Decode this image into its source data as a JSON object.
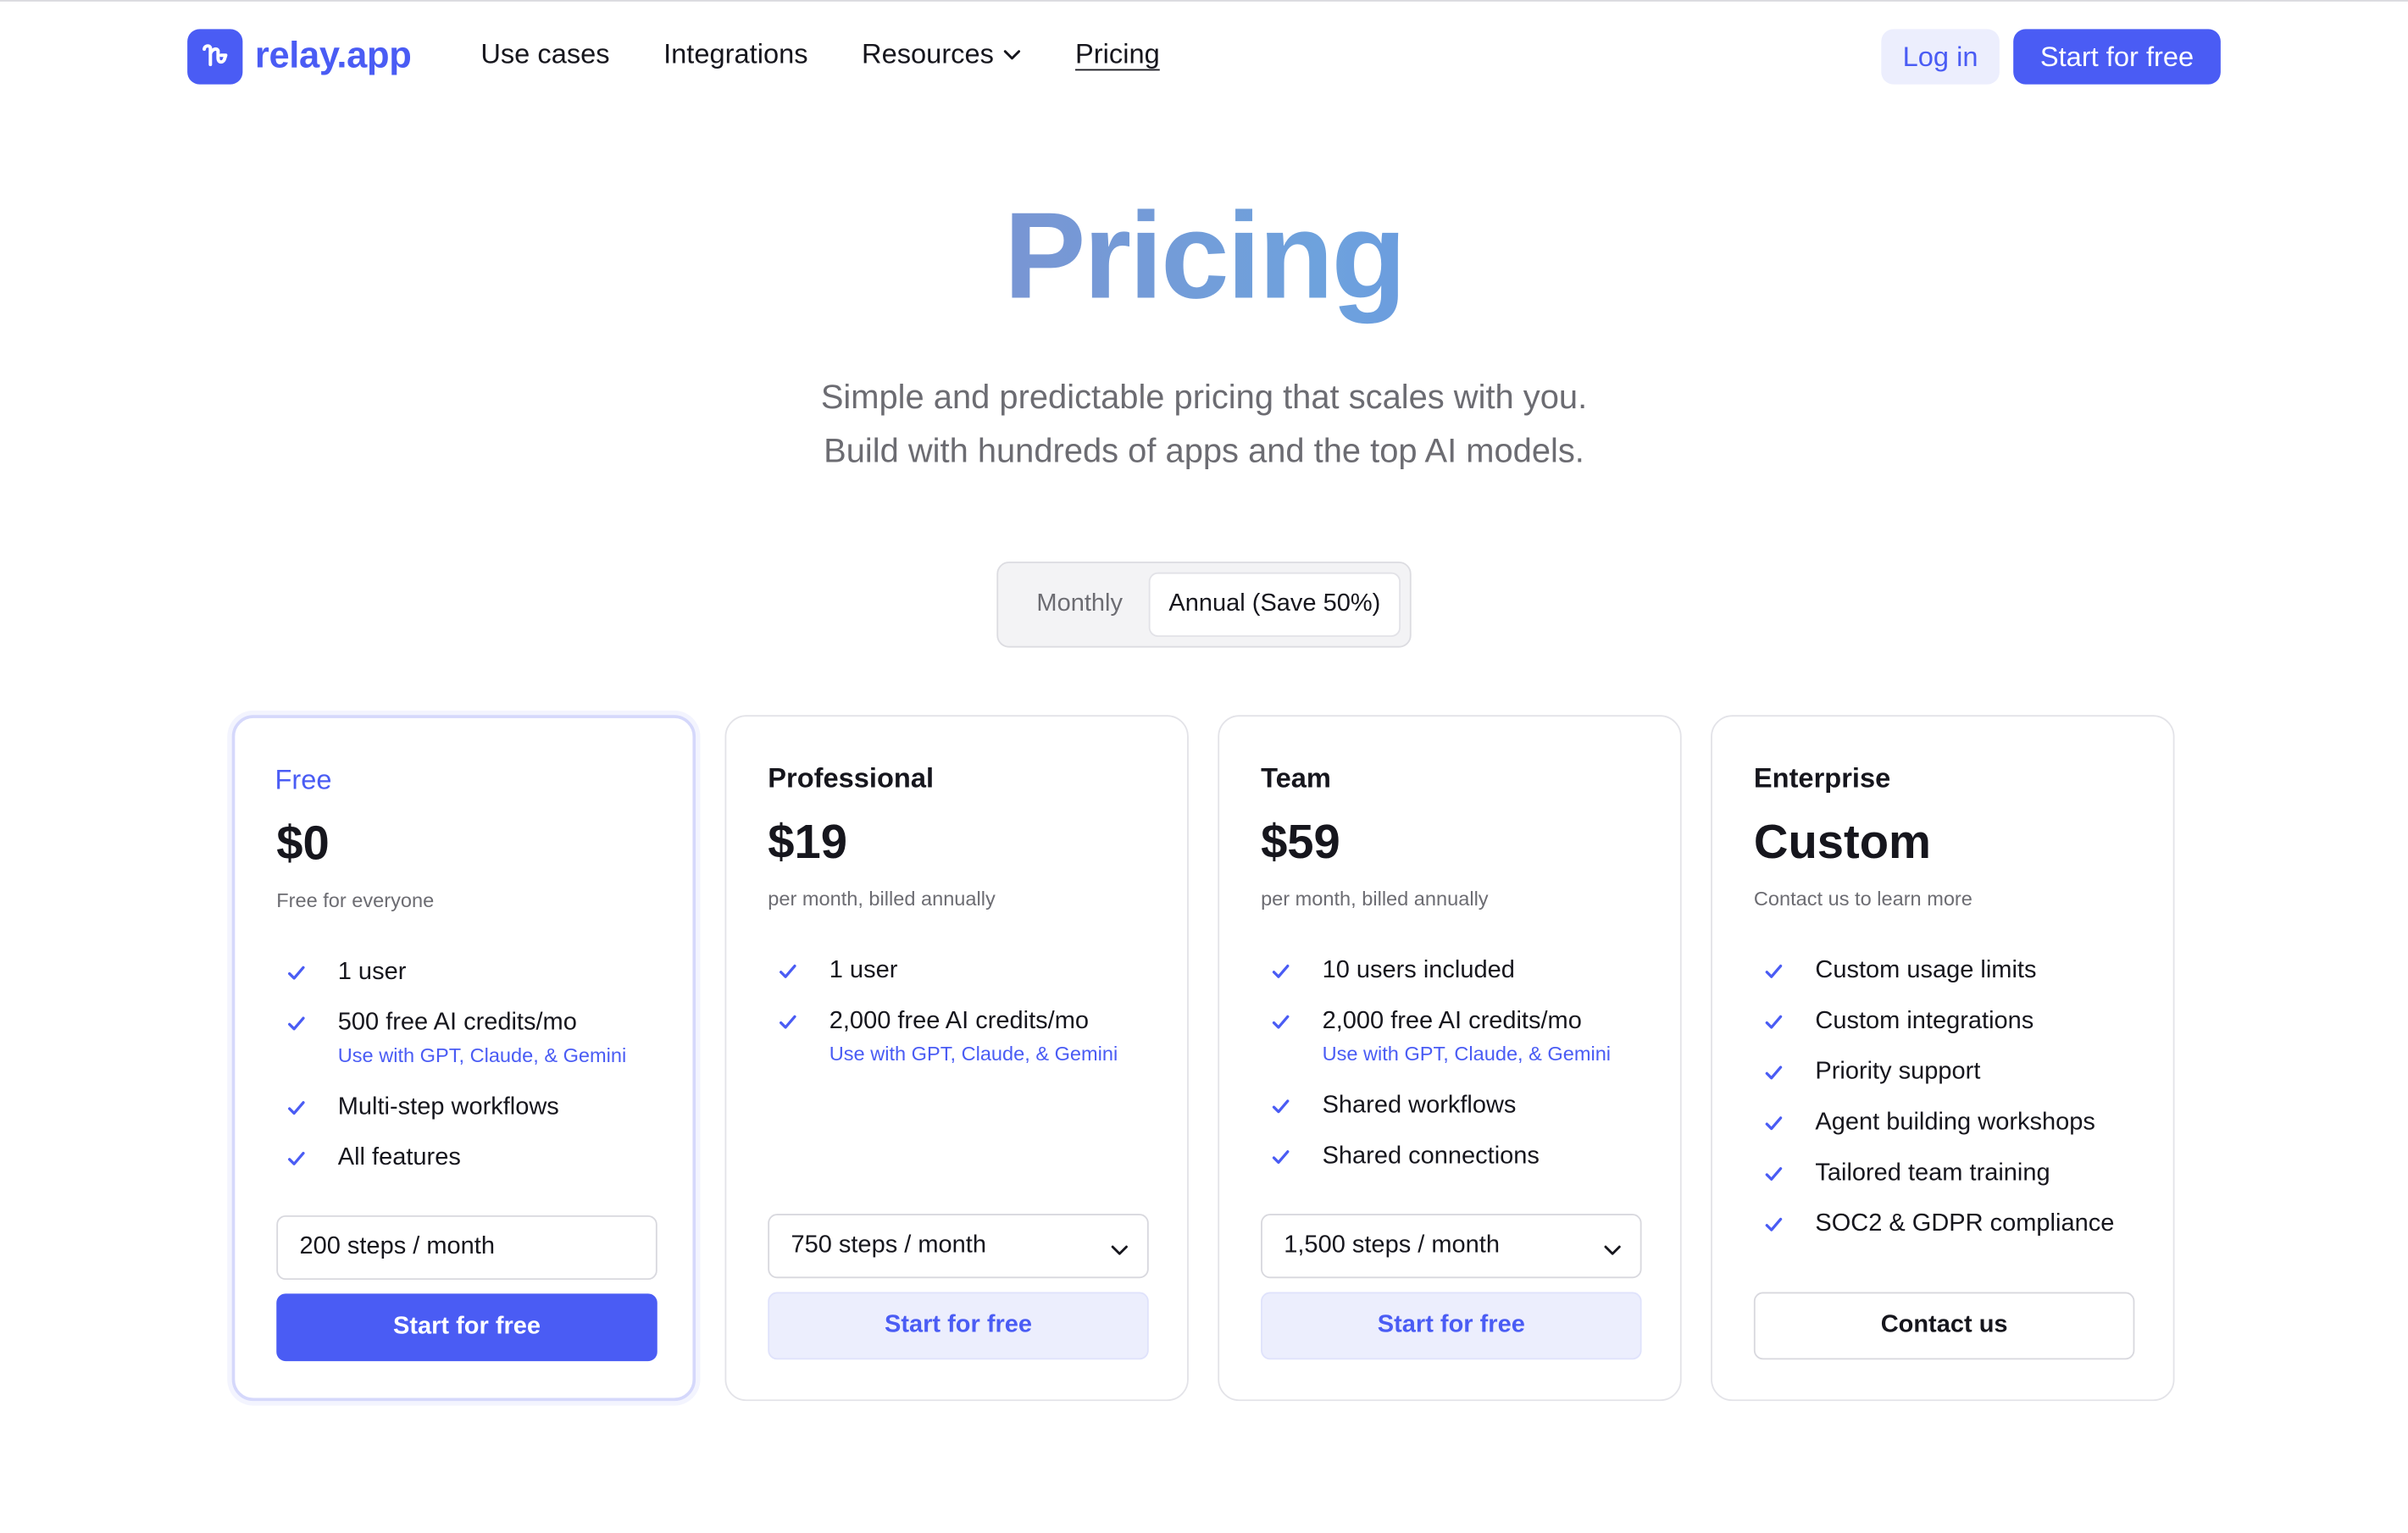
{
  "brand": {
    "name": "relay.app"
  },
  "nav": {
    "links": [
      "Use cases",
      "Integrations",
      "Resources",
      "Pricing"
    ],
    "login": "Log in",
    "start": "Start for free"
  },
  "hero": {
    "title": "Pricing",
    "subtitle_line1": "Simple and predictable pricing that scales with you.",
    "subtitle_line2": "Build with hundreds of apps and the top AI models."
  },
  "billing_toggle": {
    "options": [
      "Monthly",
      "Annual (Save 50%)"
    ],
    "selected": "Annual (Save 50%)"
  },
  "accent_color": "#4a5cf4",
  "plans": [
    {
      "name": "Free",
      "price": "$0",
      "price_note": "Free for everyone",
      "features": [
        {
          "text": "1 user"
        },
        {
          "text": "500 free AI credits/mo",
          "sub": "Use with GPT, Claude, & Gemini"
        },
        {
          "text": "Multi-step workflows"
        },
        {
          "text": "All features"
        }
      ],
      "steps": "200 steps / month",
      "cta": "Start for free"
    },
    {
      "name": "Professional",
      "price": "$19",
      "price_note": "per month, billed annually",
      "features": [
        {
          "text": "1 user"
        },
        {
          "text": "2,000 free AI credits/mo",
          "sub": "Use with GPT, Claude, & Gemini"
        }
      ],
      "steps": "750 steps / month",
      "cta": "Start for free"
    },
    {
      "name": "Team",
      "price": "$59",
      "price_note": "per month, billed annually",
      "features": [
        {
          "text": "10 users included"
        },
        {
          "text": "2,000 free AI credits/mo",
          "sub": "Use with GPT, Claude, & Gemini"
        },
        {
          "text": "Shared workflows"
        },
        {
          "text": "Shared connections"
        }
      ],
      "steps": "1,500 steps / month",
      "cta": "Start for free"
    },
    {
      "name": "Enterprise",
      "price": "Custom",
      "price_note": "Contact us to learn more",
      "features": [
        {
          "text": "Custom usage limits"
        },
        {
          "text": "Custom integrations"
        },
        {
          "text": "Priority support"
        },
        {
          "text": "Agent building workshops"
        },
        {
          "text": "Tailored team training"
        },
        {
          "text": "SOC2 & GDPR compliance"
        }
      ],
      "cta": "Contact us"
    }
  ]
}
